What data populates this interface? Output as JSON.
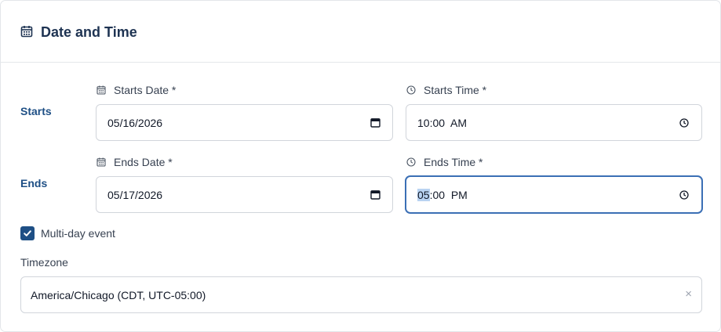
{
  "header": {
    "title": "Date and Time",
    "icon": "calendar-icon"
  },
  "rows": {
    "starts_label": "Starts",
    "ends_label": "Ends"
  },
  "starts_date": {
    "label": "Starts Date *",
    "value": "05/16/2026",
    "icon": "calendar-icon"
  },
  "starts_time": {
    "label": "Starts Time *",
    "value": "10:00  AM",
    "icon": "clock-icon"
  },
  "ends_date": {
    "label": "Ends Date *",
    "value": "05/17/2026",
    "icon": "calendar-icon"
  },
  "ends_time": {
    "label": "Ends Time *",
    "hour": "05",
    "rest": ":00  PM",
    "icon": "clock-icon"
  },
  "multi_day": {
    "label": "Multi-day event",
    "checked": true
  },
  "timezone": {
    "label": "Timezone",
    "value": "America/Chicago (CDT, UTC-05:00)",
    "clear": "×"
  },
  "colors": {
    "accent": "#1e4f85",
    "focus": "#3b6fb5",
    "title": "#1e3352"
  }
}
